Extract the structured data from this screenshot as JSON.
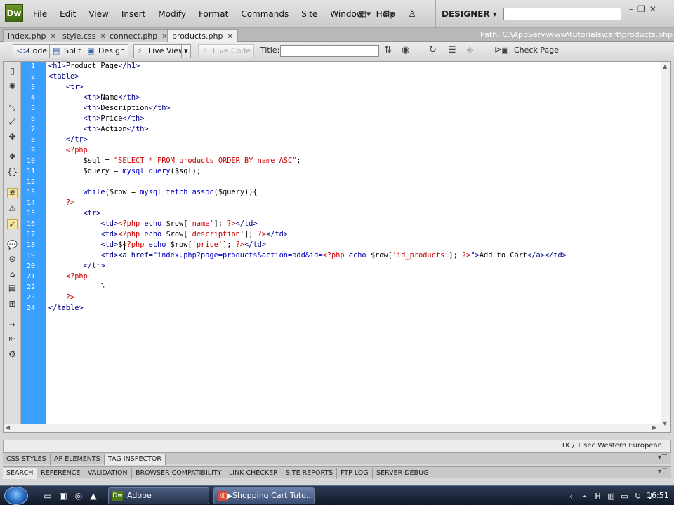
{
  "app": {
    "logo": "Dw",
    "workspace": "DESIGNER"
  },
  "menus": [
    "File",
    "Edit",
    "View",
    "Insert",
    "Modify",
    "Format",
    "Commands",
    "Site",
    "Window",
    "Help"
  ],
  "tabs": [
    {
      "label": "index.php",
      "active": false
    },
    {
      "label": "style.css",
      "active": false
    },
    {
      "label": "connect.php",
      "active": false
    },
    {
      "label": "products.php",
      "active": true
    }
  ],
  "path": "Path:  C:\\AppServ\\www\\tutorials\\cart\\products.php",
  "toolbar": {
    "code": "Code",
    "split": "Split",
    "design": "Design",
    "live_view": "Live View",
    "live_code": "Live Code",
    "title_label": "Title:",
    "title_value": "",
    "check_page": "Check Page"
  },
  "line_numbers": [
    "1",
    "2",
    "3",
    "4",
    "5",
    "6",
    "7",
    "8",
    "9",
    "10",
    "11",
    "12",
    "13",
    "14",
    "15",
    "16",
    "17",
    "18",
    "19",
    "20",
    "21",
    "22",
    "23",
    "24"
  ],
  "code": [
    [
      {
        "c": "t",
        "x": "<h1>"
      },
      {
        "c": "w",
        "x": "Product Page"
      },
      {
        "c": "t",
        "x": "</h1>"
      }
    ],
    [
      {
        "c": "t",
        "x": "<table>"
      }
    ],
    [
      {
        "c": "w",
        "x": "    "
      },
      {
        "c": "t",
        "x": "<tr>"
      }
    ],
    [
      {
        "c": "w",
        "x": "        "
      },
      {
        "c": "t",
        "x": "<th>"
      },
      {
        "c": "w",
        "x": "Name"
      },
      {
        "c": "t",
        "x": "</th>"
      }
    ],
    [
      {
        "c": "w",
        "x": "        "
      },
      {
        "c": "t",
        "x": "<th>"
      },
      {
        "c": "w",
        "x": "Description"
      },
      {
        "c": "t",
        "x": "</th>"
      }
    ],
    [
      {
        "c": "w",
        "x": "        "
      },
      {
        "c": "t",
        "x": "<th>"
      },
      {
        "c": "w",
        "x": "Price"
      },
      {
        "c": "t",
        "x": "</th>"
      }
    ],
    [
      {
        "c": "w",
        "x": "        "
      },
      {
        "c": "t",
        "x": "<th>"
      },
      {
        "c": "w",
        "x": "Action"
      },
      {
        "c": "t",
        "x": "</th>"
      }
    ],
    [
      {
        "c": "w",
        "x": "    "
      },
      {
        "c": "t",
        "x": "</tr>"
      }
    ],
    [
      {
        "c": "w",
        "x": "    "
      },
      {
        "c": "p",
        "x": "<?php"
      }
    ],
    [
      {
        "c": "w",
        "x": "        "
      },
      {
        "c": "v",
        "x": "$sql"
      },
      {
        "c": "w",
        "x": " = "
      },
      {
        "c": "s",
        "x": "\"SELECT * FROM products ORDER BY name ASC\""
      },
      {
        "c": "w",
        "x": ";"
      }
    ],
    [
      {
        "c": "w",
        "x": "        "
      },
      {
        "c": "v",
        "x": "$query"
      },
      {
        "c": "w",
        "x": " = "
      },
      {
        "c": "f",
        "x": "mysql_query"
      },
      {
        "c": "w",
        "x": "("
      },
      {
        "c": "v",
        "x": "$sql"
      },
      {
        "c": "w",
        "x": ");"
      }
    ],
    [
      {
        "c": "w",
        "x": ""
      }
    ],
    [
      {
        "c": "w",
        "x": "        "
      },
      {
        "c": "kw",
        "x": "while"
      },
      {
        "c": "w",
        "x": "("
      },
      {
        "c": "v",
        "x": "$row"
      },
      {
        "c": "w",
        "x": " = "
      },
      {
        "c": "f",
        "x": "mysql_fetch_assoc"
      },
      {
        "c": "w",
        "x": "("
      },
      {
        "c": "v",
        "x": "$query"
      },
      {
        "c": "w",
        "x": ")){"
      }
    ],
    [
      {
        "c": "w",
        "x": "    "
      },
      {
        "c": "p",
        "x": "?>"
      }
    ],
    [
      {
        "c": "w",
        "x": "        "
      },
      {
        "c": "t",
        "x": "<tr>"
      }
    ],
    [
      {
        "c": "w",
        "x": "            "
      },
      {
        "c": "t",
        "x": "<td>"
      },
      {
        "c": "p",
        "x": "<?php"
      },
      {
        "c": "w",
        "x": " "
      },
      {
        "c": "kw",
        "x": "echo"
      },
      {
        "c": "w",
        "x": " "
      },
      {
        "c": "v",
        "x": "$row"
      },
      {
        "c": "w",
        "x": "["
      },
      {
        "c": "s",
        "x": "'name'"
      },
      {
        "c": "w",
        "x": "]; "
      },
      {
        "c": "p",
        "x": "?>"
      },
      {
        "c": "t",
        "x": "</td>"
      }
    ],
    [
      {
        "c": "w",
        "x": "            "
      },
      {
        "c": "t",
        "x": "<td>"
      },
      {
        "c": "p",
        "x": "<?php"
      },
      {
        "c": "w",
        "x": " "
      },
      {
        "c": "kw",
        "x": "echo"
      },
      {
        "c": "w",
        "x": " "
      },
      {
        "c": "v",
        "x": "$row"
      },
      {
        "c": "w",
        "x": "["
      },
      {
        "c": "s",
        "x": "'description'"
      },
      {
        "c": "w",
        "x": "]; "
      },
      {
        "c": "p",
        "x": "?>"
      },
      {
        "c": "t",
        "x": "</td>"
      }
    ],
    [
      {
        "c": "w",
        "x": "            "
      },
      {
        "c": "t",
        "x": "<td>"
      },
      {
        "c": "w",
        "x": "$"
      },
      {
        "c": "p",
        "x": "<?php"
      },
      {
        "c": "w",
        "x": " "
      },
      {
        "c": "kw",
        "x": "echo"
      },
      {
        "c": "w",
        "x": " "
      },
      {
        "c": "v",
        "x": "$row"
      },
      {
        "c": "w",
        "x": "["
      },
      {
        "c": "s",
        "x": "'price'"
      },
      {
        "c": "w",
        "x": "]; "
      },
      {
        "c": "p",
        "x": "?>"
      },
      {
        "c": "t",
        "x": "</td>"
      }
    ],
    [
      {
        "c": "w",
        "x": "            "
      },
      {
        "c": "t",
        "x": "<td><a href="
      },
      {
        "c": "f",
        "x": "\"index.php?page=products&action=add&id="
      },
      {
        "c": "p",
        "x": "<?php"
      },
      {
        "c": "w",
        "x": " "
      },
      {
        "c": "kw",
        "x": "echo"
      },
      {
        "c": "w",
        "x": " "
      },
      {
        "c": "v",
        "x": "$row"
      },
      {
        "c": "w",
        "x": "["
      },
      {
        "c": "s",
        "x": "'id_products'"
      },
      {
        "c": "w",
        "x": "]; "
      },
      {
        "c": "p",
        "x": "?>"
      },
      {
        "c": "f",
        "x": "\""
      },
      {
        "c": "t",
        "x": ">"
      },
      {
        "c": "w",
        "x": "Add to Cart"
      },
      {
        "c": "t",
        "x": "</a></td>"
      }
    ],
    [
      {
        "c": "w",
        "x": "        "
      },
      {
        "c": "t",
        "x": "</tr>"
      }
    ],
    [
      {
        "c": "w",
        "x": "    "
      },
      {
        "c": "p",
        "x": "<?php"
      }
    ],
    [
      {
        "c": "w",
        "x": "            }"
      }
    ],
    [
      {
        "c": "w",
        "x": "    "
      },
      {
        "c": "p",
        "x": "?>"
      }
    ],
    [
      {
        "c": "t",
        "x": "</table>"
      }
    ]
  ],
  "status": {
    "right": "1K / 1 sec   Western European"
  },
  "panels_top": [
    {
      "label": "CSS STYLES",
      "active": false
    },
    {
      "label": "AP ELEMENTS",
      "active": false
    },
    {
      "label": "TAG INSPECTOR",
      "active": true
    }
  ],
  "panels_bottom": [
    {
      "label": "SEARCH",
      "active": true
    },
    {
      "label": "REFERENCE",
      "active": false
    },
    {
      "label": "VALIDATION",
      "active": false
    },
    {
      "label": "BROWSER COMPATIBILITY",
      "active": false
    },
    {
      "label": "LINK CHECKER",
      "active": false
    },
    {
      "label": "SITE REPORTS",
      "active": false
    },
    {
      "label": "FTP LOG",
      "active": false
    },
    {
      "label": "SERVER DEBUG",
      "active": false
    }
  ],
  "taskbar": {
    "items": [
      {
        "label": "Adobe Dreamweave...",
        "icon": "Dw"
      },
      {
        "label": "Shopping Cart Tuto...",
        "icon": ""
      }
    ],
    "clock": "16:51"
  }
}
